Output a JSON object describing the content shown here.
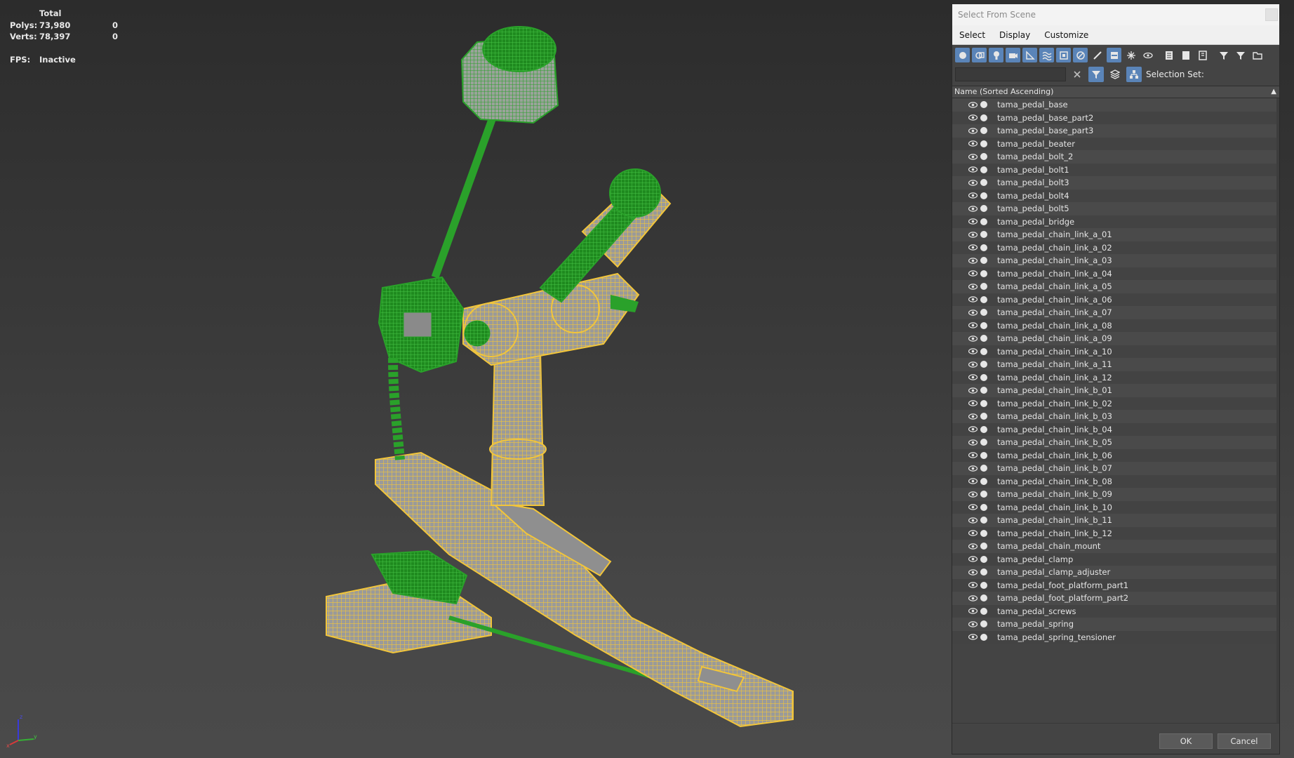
{
  "stats": {
    "total_label": "Total",
    "polys_label": "Polys:",
    "polys_total": "73,980",
    "polys_selected": "0",
    "verts_label": "Verts:",
    "verts_total": "78,397",
    "verts_selected": "0",
    "fps_label": "FPS:",
    "fps_value": "Inactive"
  },
  "viewport": {
    "axis_labels": {
      "z": "z",
      "x": "x",
      "y": "y"
    },
    "colors": {
      "selected_wire": "#2aa12a",
      "unselected_wire": "#f2c53a",
      "background_top": "#2c2c2c",
      "background_bottom": "#4a4a4a"
    }
  },
  "dialog": {
    "title": "Select From Scene",
    "menus": [
      "Select",
      "Display",
      "Customize"
    ],
    "toolbar_icons": [
      "geometry-icon",
      "shapes-icon",
      "lights-icon",
      "cameras-icon",
      "helpers-icon",
      "space-warps-icon",
      "groups-icon",
      "xrefs-icon",
      "bones-icon",
      "containers-icon",
      "frozen-icon",
      "hidden-icon",
      "display-all-icon",
      "display-none-icon",
      "invert-display-icon",
      "filter-children-icon",
      "filter-icon",
      "open-folder-icon"
    ],
    "search": {
      "value": "",
      "placeholder": ""
    },
    "selection_set_label": "Selection Set:",
    "column_header": "Name (Sorted Ascending)",
    "items": [
      "tama_pedal_base",
      "tama_pedal_base_part2",
      "tama_pedal_base_part3",
      "tama_pedal_beater",
      "tama_pedal_bolt_2",
      "tama_pedal_bolt1",
      "tama_pedal_bolt3",
      "tama_pedal_bolt4",
      "tama_pedal_bolt5",
      "tama_pedal_bridge",
      "tama_pedal_chain_link_a_01",
      "tama_pedal_chain_link_a_02",
      "tama_pedal_chain_link_a_03",
      "tama_pedal_chain_link_a_04",
      "tama_pedal_chain_link_a_05",
      "tama_pedal_chain_link_a_06",
      "tama_pedal_chain_link_a_07",
      "tama_pedal_chain_link_a_08",
      "tama_pedal_chain_link_a_09",
      "tama_pedal_chain_link_a_10",
      "tama_pedal_chain_link_a_11",
      "tama_pedal_chain_link_a_12",
      "tama_pedal_chain_link_b_01",
      "tama_pedal_chain_link_b_02",
      "tama_pedal_chain_link_b_03",
      "tama_pedal_chain_link_b_04",
      "tama_pedal_chain_link_b_05",
      "tama_pedal_chain_link_b_06",
      "tama_pedal_chain_link_b_07",
      "tama_pedal_chain_link_b_08",
      "tama_pedal_chain_link_b_09",
      "tama_pedal_chain_link_b_10",
      "tama_pedal_chain_link_b_11",
      "tama_pedal_chain_link_b_12",
      "tama_pedal_chain_mount",
      "tama_pedal_clamp",
      "tama_pedal_clamp_adjuster",
      "tama_pedal_foot_platform_part1",
      "tama_pedal_foot_platform_part2",
      "tama_pedal_screws",
      "tama_pedal_spring",
      "tama_pedal_spring_tensioner"
    ],
    "ok_label": "OK",
    "cancel_label": "Cancel",
    "accent_color": "#5a84b8"
  }
}
